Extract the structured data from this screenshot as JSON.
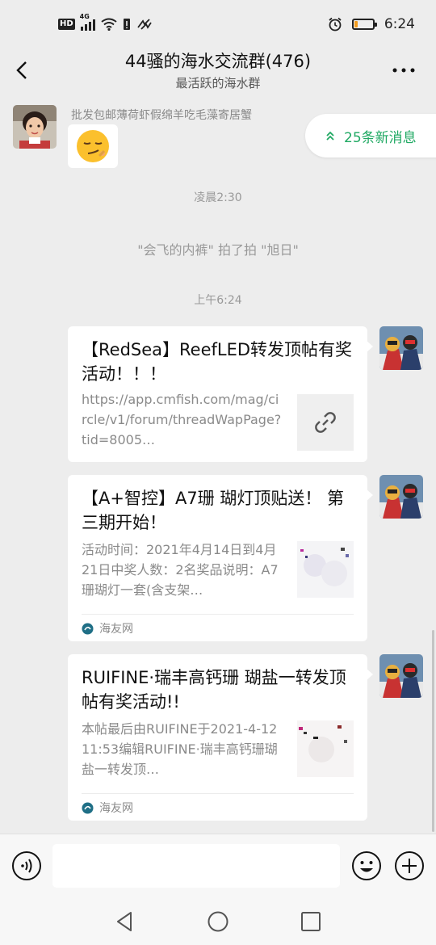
{
  "status_bar": {
    "hd": "HD",
    "network": "4G",
    "time": "6:24",
    "battery_level": 0.18
  },
  "header": {
    "title": "44骚的海水交流群(476)",
    "subtitle": "最活跃的海水群",
    "back_icon": "chevron-left-icon",
    "more_icon": "more-horizontal-icon"
  },
  "new_messages": {
    "label": "25条新消息",
    "icon": "double-chevron-up-icon",
    "color": "#20a963"
  },
  "messages": [
    {
      "type": "emoji",
      "sender": "批发包邮薄荷虾假绵羊吃毛藻寄居蟹",
      "emoji": "😏"
    },
    {
      "type": "time",
      "text": "凌晨2:30"
    },
    {
      "type": "system",
      "text": "\"会飞的内裤\" 拍了拍 \"旭日\""
    },
    {
      "type": "time",
      "text": "上午6:24"
    },
    {
      "type": "link_card",
      "title": "【RedSea】ReefLED转发顶帖有奖活动！！！",
      "desc": "https://app.cmfish.com/mag/circle/v1/forum/threadWapPage?tid=8005…",
      "thumb_icon": "link-icon"
    },
    {
      "type": "link_card",
      "title": "【A+智控】A7珊 瑚灯顶贴送！ 第三期开始！",
      "desc": "活动时间：2021年4月14日到4月21日中奖人数：2名奖品说明：A7珊瑚灯一套(含支架…",
      "source": "海友网"
    },
    {
      "type": "link_card",
      "title": "RUIFINE·瑞丰高钙珊 瑚盐一转发顶帖有奖活动!!",
      "desc": "本帖最后由RUIFINE于2021-4-1211:53编辑RUIFINE·瑞丰高钙珊瑚盐一转发顶…",
      "source": "海友网"
    }
  ],
  "input_bar": {
    "voice_icon": "voice-icon",
    "emoji_icon": "emoji-icon",
    "plus_icon": "plus-icon",
    "placeholder": ""
  },
  "nav_bar": {
    "icons": [
      "back-triangle-icon",
      "home-circle-icon",
      "recents-square-icon"
    ]
  }
}
